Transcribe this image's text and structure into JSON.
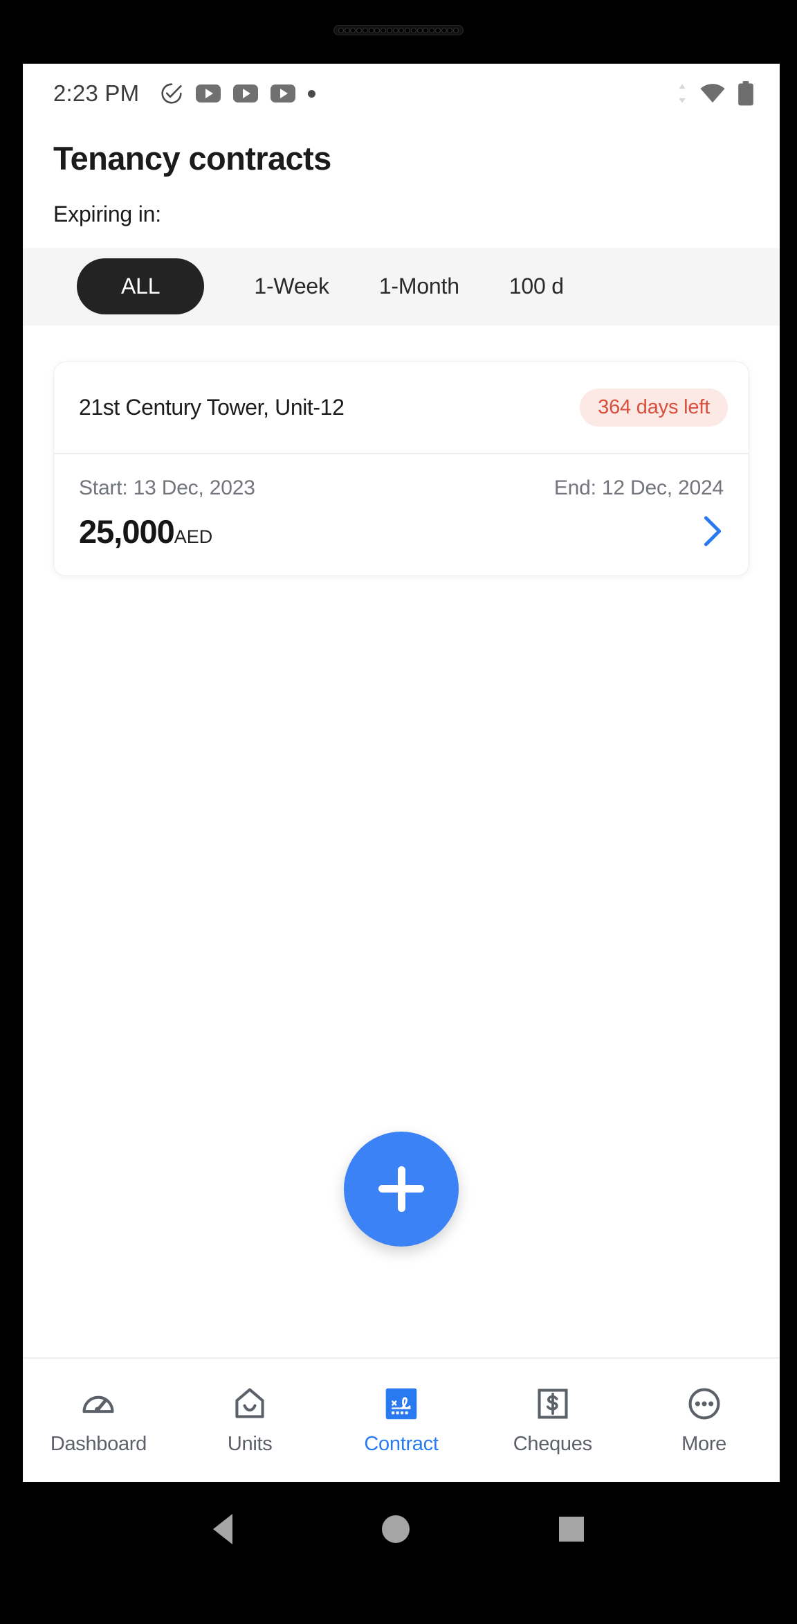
{
  "statusbar": {
    "time": "2:23 PM",
    "left_icons": [
      "check-circle-icon",
      "youtube-icon",
      "youtube-icon",
      "youtube-icon",
      "dot-icon"
    ],
    "right_icons": [
      "mobile-data-icon",
      "wifi-icon",
      "battery-icon"
    ]
  },
  "header": {
    "title": "Tenancy contracts",
    "subtitle": "Expiring in:"
  },
  "filters": {
    "chips": [
      {
        "label": "ALL",
        "selected": true
      },
      {
        "label": "1-Week",
        "selected": false
      },
      {
        "label": "1-Month",
        "selected": false
      },
      {
        "label": "100 d",
        "selected": false
      }
    ]
  },
  "contracts": [
    {
      "title": "21st Century Tower, Unit-12",
      "badge": "364 days left",
      "start": "Start: 13 Dec, 2023",
      "end": "End: 12 Dec, 2024",
      "amount": "25,000",
      "currency": "AED"
    }
  ],
  "fab": {
    "icon": "plus-icon",
    "color": "#3b82f6"
  },
  "bottomnav": {
    "items": [
      {
        "label": "Dashboard",
        "icon": "dashboard-gauge-icon",
        "active": false
      },
      {
        "label": "Units",
        "icon": "home-icon",
        "active": false
      },
      {
        "label": "Contract",
        "icon": "contract-signature-icon",
        "active": true
      },
      {
        "label": "Cheques",
        "icon": "dollar-square-icon",
        "active": false
      },
      {
        "label": "More",
        "icon": "more-circle-icon",
        "active": false
      }
    ]
  },
  "androidnav": {
    "back": "back-triangle-icon",
    "home": "home-circle-icon",
    "recents": "recents-square-icon"
  },
  "colors": {
    "accent": "#3b82f6",
    "badge_bg": "#fce9e6",
    "badge_text": "#d9503c",
    "chip_selected_bg": "#232323",
    "chips_bar_bg": "#f5f5f6"
  }
}
